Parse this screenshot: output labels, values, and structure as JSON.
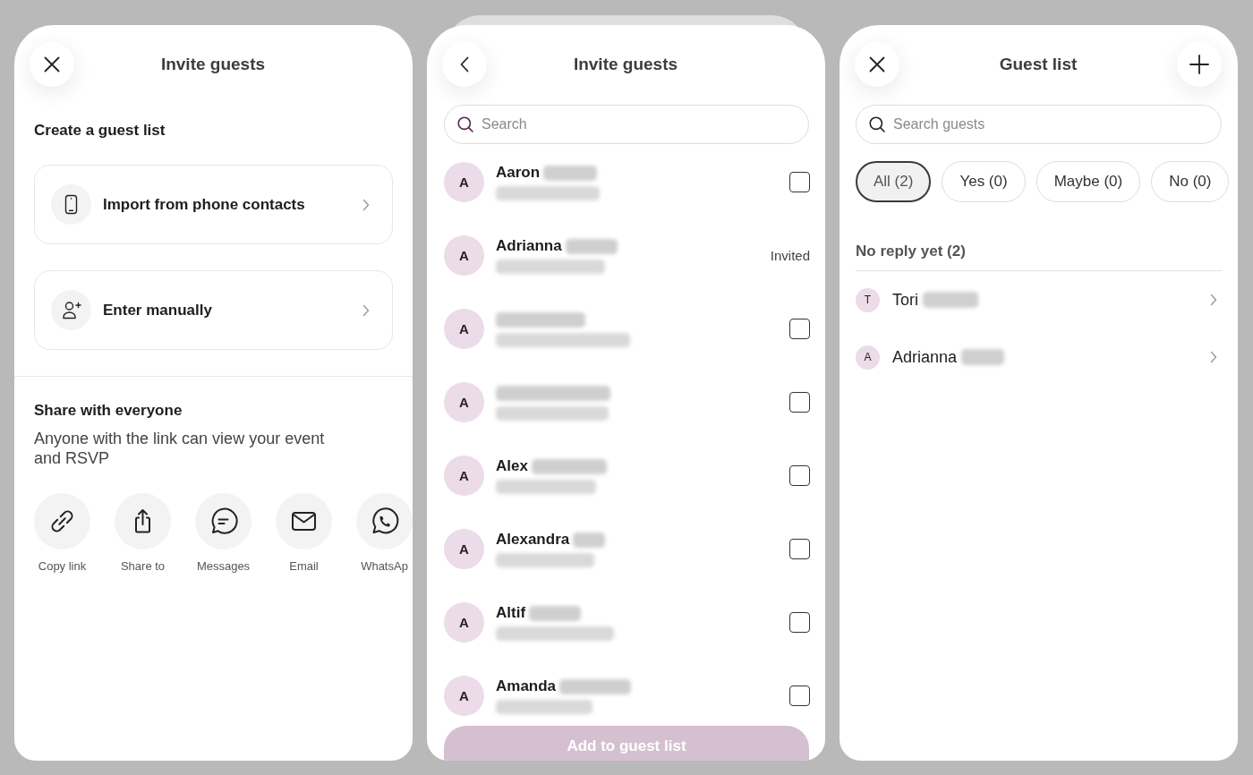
{
  "screens": [
    {
      "kind": "invite_options",
      "header": {
        "left_button": {
          "kind": "close"
        },
        "title": "Invite guests"
      },
      "create_section": {
        "heading": "Create a guest list",
        "options": [
          {
            "kind": "import_contacts",
            "label": "Import from phone contacts"
          },
          {
            "kind": "enter_manually",
            "label": "Enter manually"
          }
        ]
      },
      "share_section": {
        "heading": "Share with everyone",
        "description": "Anyone with the link can view your event and RSVP",
        "targets": [
          {
            "kind": "copy_link",
            "label": "Copy link"
          },
          {
            "kind": "share_to",
            "label": "Share to"
          },
          {
            "kind": "messages",
            "label": "Messages"
          },
          {
            "kind": "email",
            "label": "Email"
          },
          {
            "kind": "whatsapp",
            "label": "WhatsAp"
          }
        ]
      }
    },
    {
      "kind": "contact_picker",
      "header": {
        "left_button": {
          "kind": "back"
        },
        "title": "Invite guests"
      },
      "search": {
        "placeholder": "Search"
      },
      "contacts": [
        {
          "initial": "A",
          "name": "Aaron",
          "kind": "selectable",
          "checked": false
        },
        {
          "initial": "A",
          "name": "Adrianna",
          "kind": "invited",
          "status": "Invited"
        },
        {
          "initial": "A",
          "kind": "selectable",
          "checked": false
        },
        {
          "initial": "A",
          "kind": "selectable",
          "checked": false
        },
        {
          "initial": "A",
          "name": "Alex",
          "kind": "selectable",
          "checked": false
        },
        {
          "initial": "A",
          "name": "Alexandra",
          "kind": "selectable",
          "checked": false
        },
        {
          "initial": "A",
          "name": "Altif",
          "kind": "selectable",
          "checked": false
        },
        {
          "initial": "A",
          "name": "Amanda",
          "kind": "selectable",
          "checked": false
        }
      ],
      "add_button": {
        "label": "Add to guest list",
        "disabled": true
      }
    },
    {
      "kind": "guest_list",
      "header": {
        "left_button": {
          "kind": "close"
        },
        "title": "Guest list",
        "right_button": {
          "kind": "add"
        }
      },
      "search": {
        "placeholder": "Search guests"
      },
      "filters": [
        {
          "label": "All (2)",
          "selected": true
        },
        {
          "label": "Yes (0)",
          "selected": false
        },
        {
          "label": "Maybe (0)",
          "selected": false
        },
        {
          "label": "No (0)",
          "selected": false
        }
      ],
      "groups": [
        {
          "heading": "No reply yet (2)",
          "guests": [
            {
              "initial": "T",
              "name": "Tori"
            },
            {
              "initial": "A",
              "name": "Adrianna"
            }
          ]
        }
      ]
    }
  ]
}
